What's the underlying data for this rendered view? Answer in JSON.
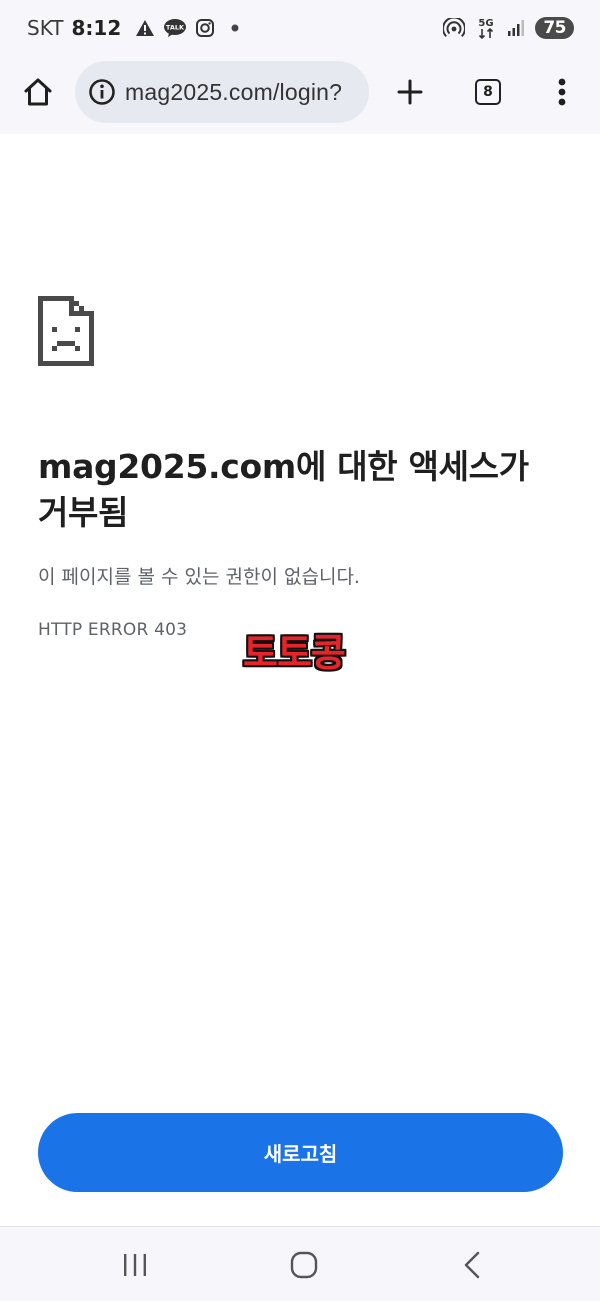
{
  "status_bar": {
    "carrier": "SKT",
    "time": "8:12",
    "battery": "75",
    "icons": [
      "warning-icon",
      "kakaotalk-icon",
      "instagram-icon",
      "dot-icon",
      "hotspot-icon",
      "5g-icon",
      "signal-icon",
      "battery-icon"
    ],
    "network_label": "5G",
    "talk_label": "TALK"
  },
  "toolbar": {
    "url": "mag2025.com/login?",
    "tab_count": "8"
  },
  "error_page": {
    "title": "mag2025.com에 대한 액세스가 거부됨",
    "description": "이 페이지를 볼 수 있는 권한이 없습니다.",
    "code": "HTTP ERROR 403",
    "watermark": "토토콩",
    "reload_label": "새로고침"
  },
  "colors": {
    "accent": "#1b73e8",
    "watermark": "#e8232a",
    "chrome_bg": "#f7f7fb",
    "url_bar_bg": "#e7e9f1"
  }
}
